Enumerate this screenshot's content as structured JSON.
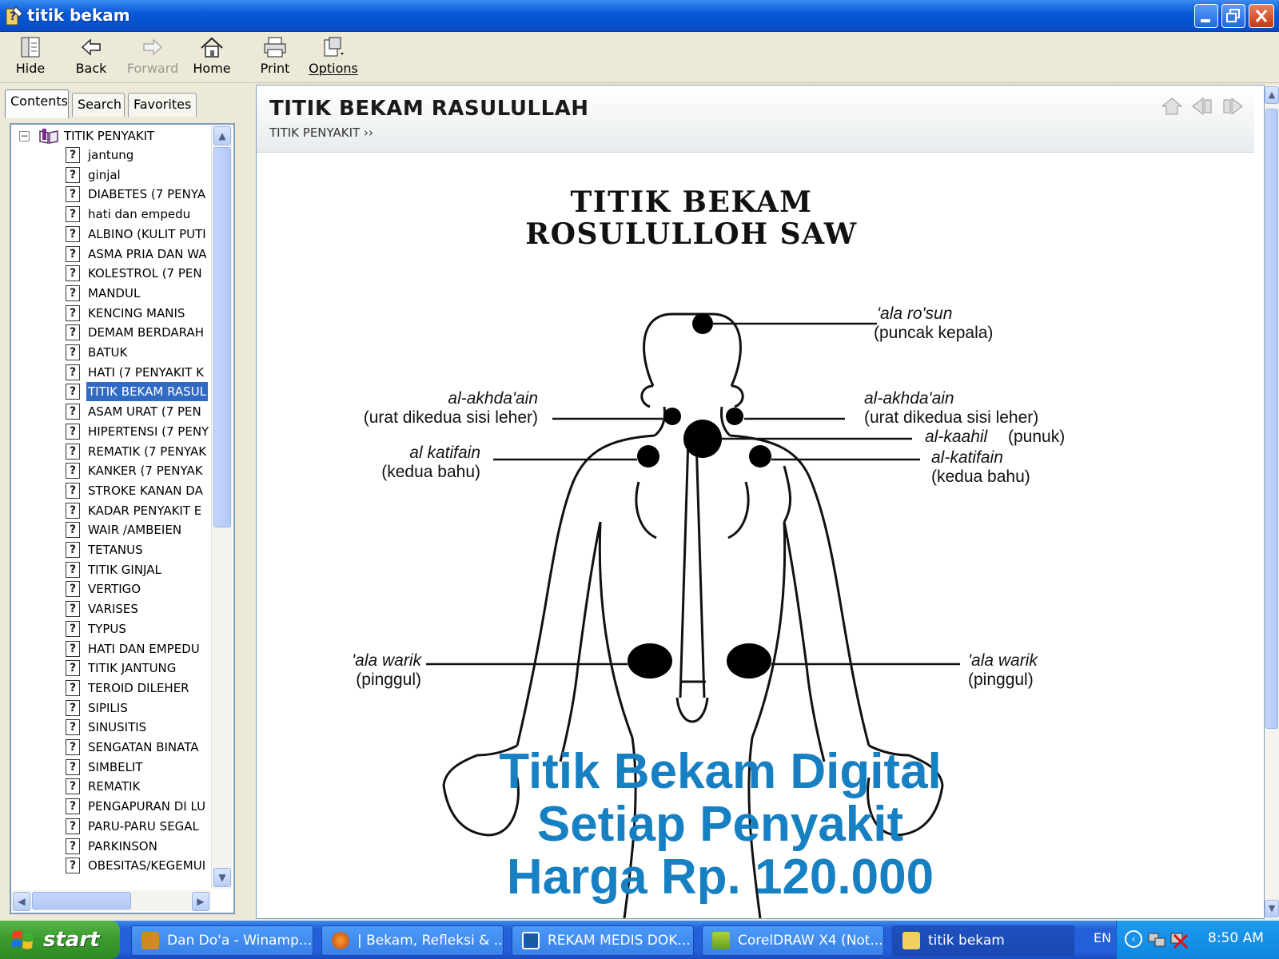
{
  "window": {
    "title": "titik bekam"
  },
  "toolbar": {
    "hide": "Hide",
    "back": "Back",
    "forward": "Forward",
    "home": "Home",
    "print": "Print",
    "options": "Options"
  },
  "tabs": {
    "contents": "Contents",
    "search": "Search",
    "favorites": "Favorites"
  },
  "tree": {
    "root": "TITIK PENYAKIT",
    "items": [
      "jantung",
      "ginjal",
      "DIABETES (7 PENYA",
      "hati dan empedu",
      "ALBINO (KULIT PUTI",
      "ASMA PRIA DAN WA",
      "KOLESTROL (7 PEN",
      "MANDUL",
      "KENCING MANIS",
      "DEMAM BERDARAH",
      "BATUK",
      "HATI (7 PENYAKIT K",
      "TITIK BEKAM RASUL",
      "ASAM URAT (7 PEN",
      "HIPERTENSI (7 PENY",
      "REMATIK (7 PENYAK",
      "KANKER (7 PENYAK",
      "STROKE  KANAN DA",
      "KADAR PENYAKIT E",
      "WAIR /AMBEIEN",
      "TETANUS",
      "TITIK GINJAL",
      "VERTIGO",
      "VARISES",
      "TYPUS",
      "HATI DAN EMPEDU",
      "TITIK JANTUNG",
      "TEROID DILEHER",
      "SIPILIS",
      "SINUSITIS",
      "SENGATAN BINATA",
      "SIMBELIT",
      "REMATIK",
      "PENGAPURAN DI LU",
      "PARU-PARU SEGAL",
      "PARKINSON",
      "OBESITAS/KEGEMUI"
    ],
    "selected_index": 12
  },
  "content": {
    "title": "TITIK BEKAM RASULULLAH",
    "breadcrumb": "TITIK PENYAKIT ››"
  },
  "illustration": {
    "heading1": "TITIK BEKAM",
    "heading2": "ROSULULLOH SAW",
    "labels": {
      "rosun_a": "'ala ro'sun",
      "rosun_b": "(puncak kepala)",
      "akhdain_l_a": "al-akhda'ain",
      "akhdain_l_b": "(urat dikedua sisi leher)",
      "akhdain_r_a": "al-akhda'ain",
      "akhdain_r_b": "(urat dikedua sisi leher)",
      "kaahil_a": "al-kaahil",
      "kaahil_b": "(punuk)",
      "katifain_l_a": "al katifain",
      "katifain_l_b": "(kedua bahu)",
      "katifain_r_a": "al-katifain",
      "katifain_r_b": "(kedua bahu)",
      "warik_l_a": "'ala warik",
      "warik_l_b": "(pinggul)",
      "warik_r_a": "'ala warik",
      "warik_r_b": "(pinggul)"
    },
    "overlay": {
      "line1": "Titik Bekam Digital",
      "line2": "Setiap Penyakit",
      "line3": "Harga Rp. 120.000"
    }
  },
  "taskbar": {
    "start": "start",
    "items": [
      "Dan Do'a - Winamp...",
      "| Bekam, Refleksi & ...",
      "REKAM MEDIS DOK...",
      "CorelDRAW X4 (Not...",
      "titik bekam"
    ],
    "language": "EN",
    "clock": "8:50 AM"
  },
  "colors": {
    "accent": "#0453d0",
    "overlay_text": "#1680c2",
    "selection": "#316ac5"
  }
}
